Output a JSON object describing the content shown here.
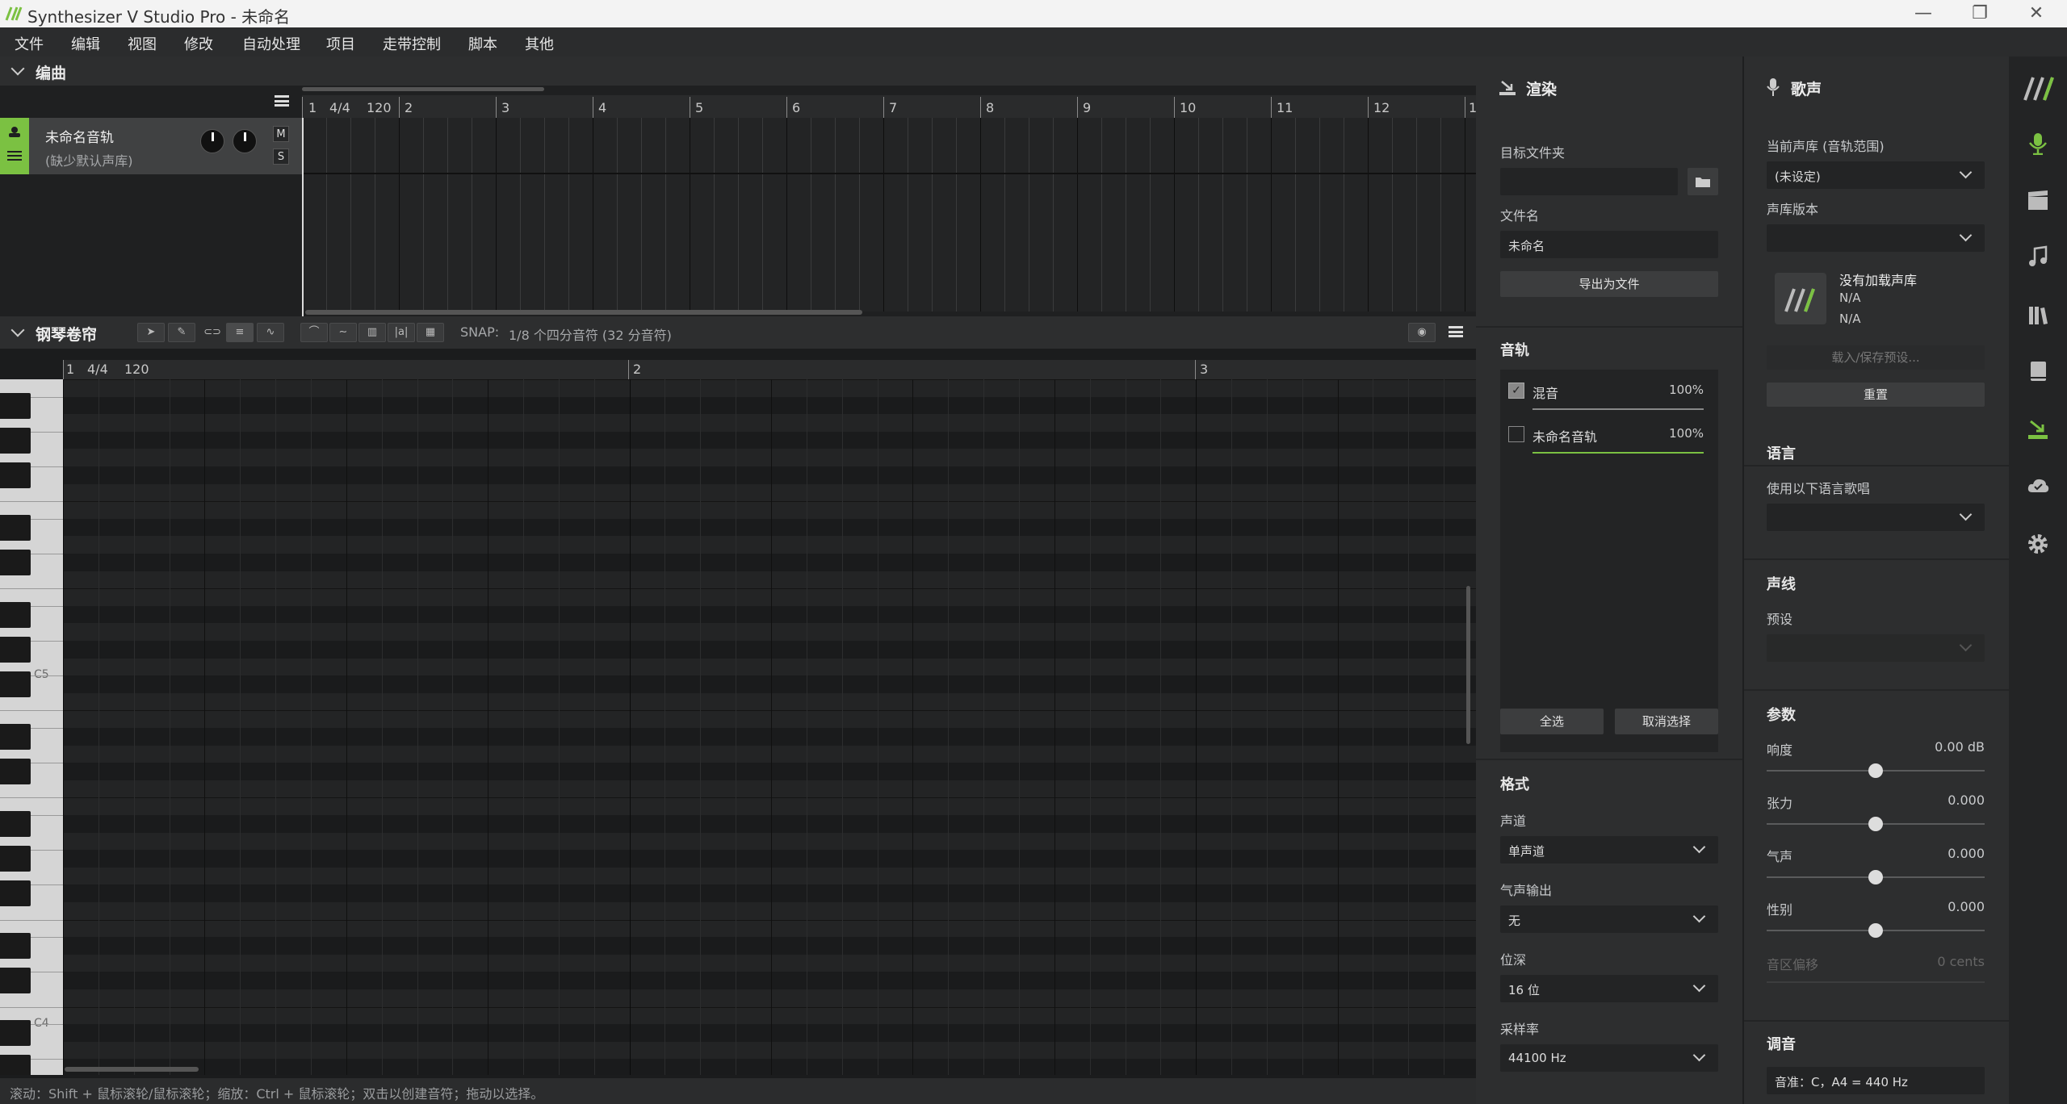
{
  "window": {
    "title": "Synthesizer V Studio Pro - 未命名",
    "minimize": "—",
    "restore": "❐",
    "close": "✕"
  },
  "menu": [
    "文件",
    "编辑",
    "视图",
    "修改",
    "自动处理",
    "项目",
    "走带控制",
    "脚本",
    "其他"
  ],
  "arrangement": {
    "title": "编曲",
    "ruler": {
      "time_signature": "4/4",
      "tempo": "120",
      "bars": [
        "1",
        "2",
        "3",
        "4",
        "5",
        "6",
        "7",
        "8",
        "9",
        "10",
        "11",
        "12",
        "1"
      ]
    },
    "track": {
      "name": "未命名音轨",
      "voice": "(缺少默认声库)",
      "mute": "M",
      "solo": "S"
    }
  },
  "piano_roll": {
    "title": "钢琴卷帘",
    "snap_label": "SNAP:",
    "snap_value": "1/8 个四分音符 (32 分音符)",
    "ruler": {
      "time_signature": "4/4",
      "tempo": "120",
      "bars": [
        "1",
        "2",
        "3"
      ]
    },
    "key_labels": [
      "C5",
      "C4"
    ]
  },
  "status": "滚动：Shift + 鼠标滚轮/鼠标滚轮；缩放：Ctrl + 鼠标滚轮；双击以创建音符；拖动以选择。",
  "render": {
    "title": "渲染",
    "target_folder_label": "目标文件夹",
    "target_folder_value": "",
    "filename_label": "文件名",
    "filename_value": "未命名",
    "export_button": "导出为文件",
    "tracks_title": "音轨",
    "tracks": [
      {
        "name": "混音",
        "volume": "100%",
        "checked": true
      },
      {
        "name": "未命名音轨",
        "volume": "100%",
        "checked": false
      }
    ],
    "select_all": "全选",
    "deselect": "取消选择",
    "format_title": "格式",
    "channel_label": "声道",
    "channel_value": "单声道",
    "breath_label": "气声输出",
    "breath_value": "无",
    "bitdepth_label": "位深",
    "bitdepth_value": "16 位",
    "samplerate_label": "采样率",
    "samplerate_value": "44100 Hz"
  },
  "voice": {
    "title": "歌声",
    "db_label": "当前声库 (音轨范围)",
    "db_value": "(未设定)",
    "version_label": "声库版本",
    "version_value": "",
    "no_db": "没有加载声库",
    "na1": "N/A",
    "na2": "N/A",
    "load_preset": "载入/保存预设...",
    "reset": "重置",
    "lang_title": "语言",
    "lang_label": "使用以下语言歌唱",
    "lang_value": "",
    "timbre_title": "声线",
    "preset_label": "预设",
    "preset_value": "",
    "params_title": "参数",
    "params": [
      {
        "name": "响度",
        "value": "0.00 dB",
        "level": 0.5
      },
      {
        "name": "张力",
        "value": "0.000",
        "level": 0.5
      },
      {
        "name": "气声",
        "value": "0.000",
        "level": 0.5
      },
      {
        "name": "性别",
        "value": "0.000",
        "level": 0.5
      }
    ],
    "pitch_shift_label": "音区偏移",
    "pitch_shift_value": "0 cents",
    "tuning_title": "调音",
    "tuning_value": "音准：C，A4 = 440 Hz"
  },
  "accent_color": "#7bc142"
}
